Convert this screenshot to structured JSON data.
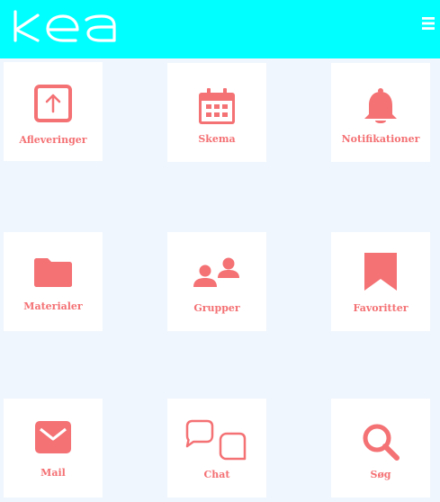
{
  "app": {
    "logo_text": "KEA",
    "menu_icon": "hamburger-icon"
  },
  "colors": {
    "header_bg": "#00ffff",
    "page_bg": "#eff6fd",
    "accent": "#f47174",
    "tile_bg": "#ffffff"
  },
  "tiles": [
    {
      "label": "Afleveringer",
      "icon": "upload-icon"
    },
    {
      "label": "Skema",
      "icon": "calendar-icon"
    },
    {
      "label": "Notifikationer",
      "icon": "bell-icon"
    },
    {
      "label": "Materialer",
      "icon": "folder-icon"
    },
    {
      "label": "Grupper",
      "icon": "group-icon"
    },
    {
      "label": "Favoritter",
      "icon": "bookmark-icon"
    },
    {
      "label": "Mail",
      "icon": "mail-icon"
    },
    {
      "label": "Chat",
      "icon": "chat-icon"
    },
    {
      "label": "Søg",
      "icon": "search-icon"
    }
  ]
}
